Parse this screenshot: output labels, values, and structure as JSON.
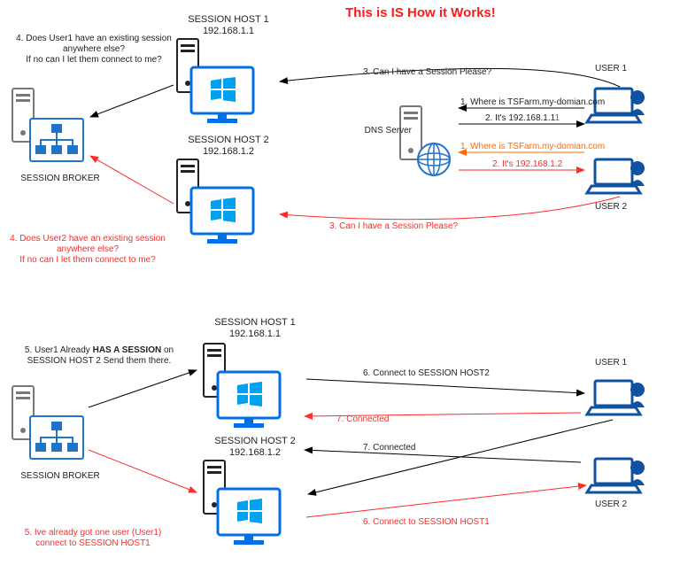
{
  "title": "This is IS How it Works!",
  "top": {
    "broker_label": "SESSION BROKER",
    "host1": {
      "name": "SESSION HOST 1",
      "ip": "192.168.1.1"
    },
    "host2": {
      "name": "SESSION HOST 2",
      "ip": "192.168.1.2"
    },
    "dns": "DNS Server",
    "user1": "USER 1",
    "user2": "USER 2",
    "msg1": "1. Where is TSFarm.my-domian.com",
    "msg2": "2. It's 192.168.1.1",
    "msg2tail": "1",
    "msg1r": "1. Where is TSFarm.my-domian.com",
    "msg2r": "2. It's 192.168.1.2",
    "msg3": "3. Can I have a Session Please?",
    "msg3r": "3. Can I have a Session Please?",
    "msg4": "4. Does User1 have an existing session\nanywhere else?\nIf no can I let them connect to me?",
    "msg4r": "4. Does User2 have an existing session\nanywhere else?\nIf no can I let them connect to me?"
  },
  "bottom": {
    "broker_label": "SESSION BROKER",
    "host1": {
      "name": "SESSION HOST 1",
      "ip": "192.168.1.1"
    },
    "host2": {
      "name": "SESSION HOST 2",
      "ip": "192.168.1.2"
    },
    "user1": "USER 1",
    "user2": "USER 2",
    "msg5": "5. User1 Already HAS A SESSION on\nSESSION HOST 2 Send them there.",
    "msg5r": "5. Ive already got one user (User1)\nconnect to SESSION HOST1",
    "msg6": "6. Connect to SESSION HOST2",
    "msg6r": "6. Connect to SESSION HOST1",
    "msg7": "7. Connected",
    "msg7r": "7. Connected"
  }
}
